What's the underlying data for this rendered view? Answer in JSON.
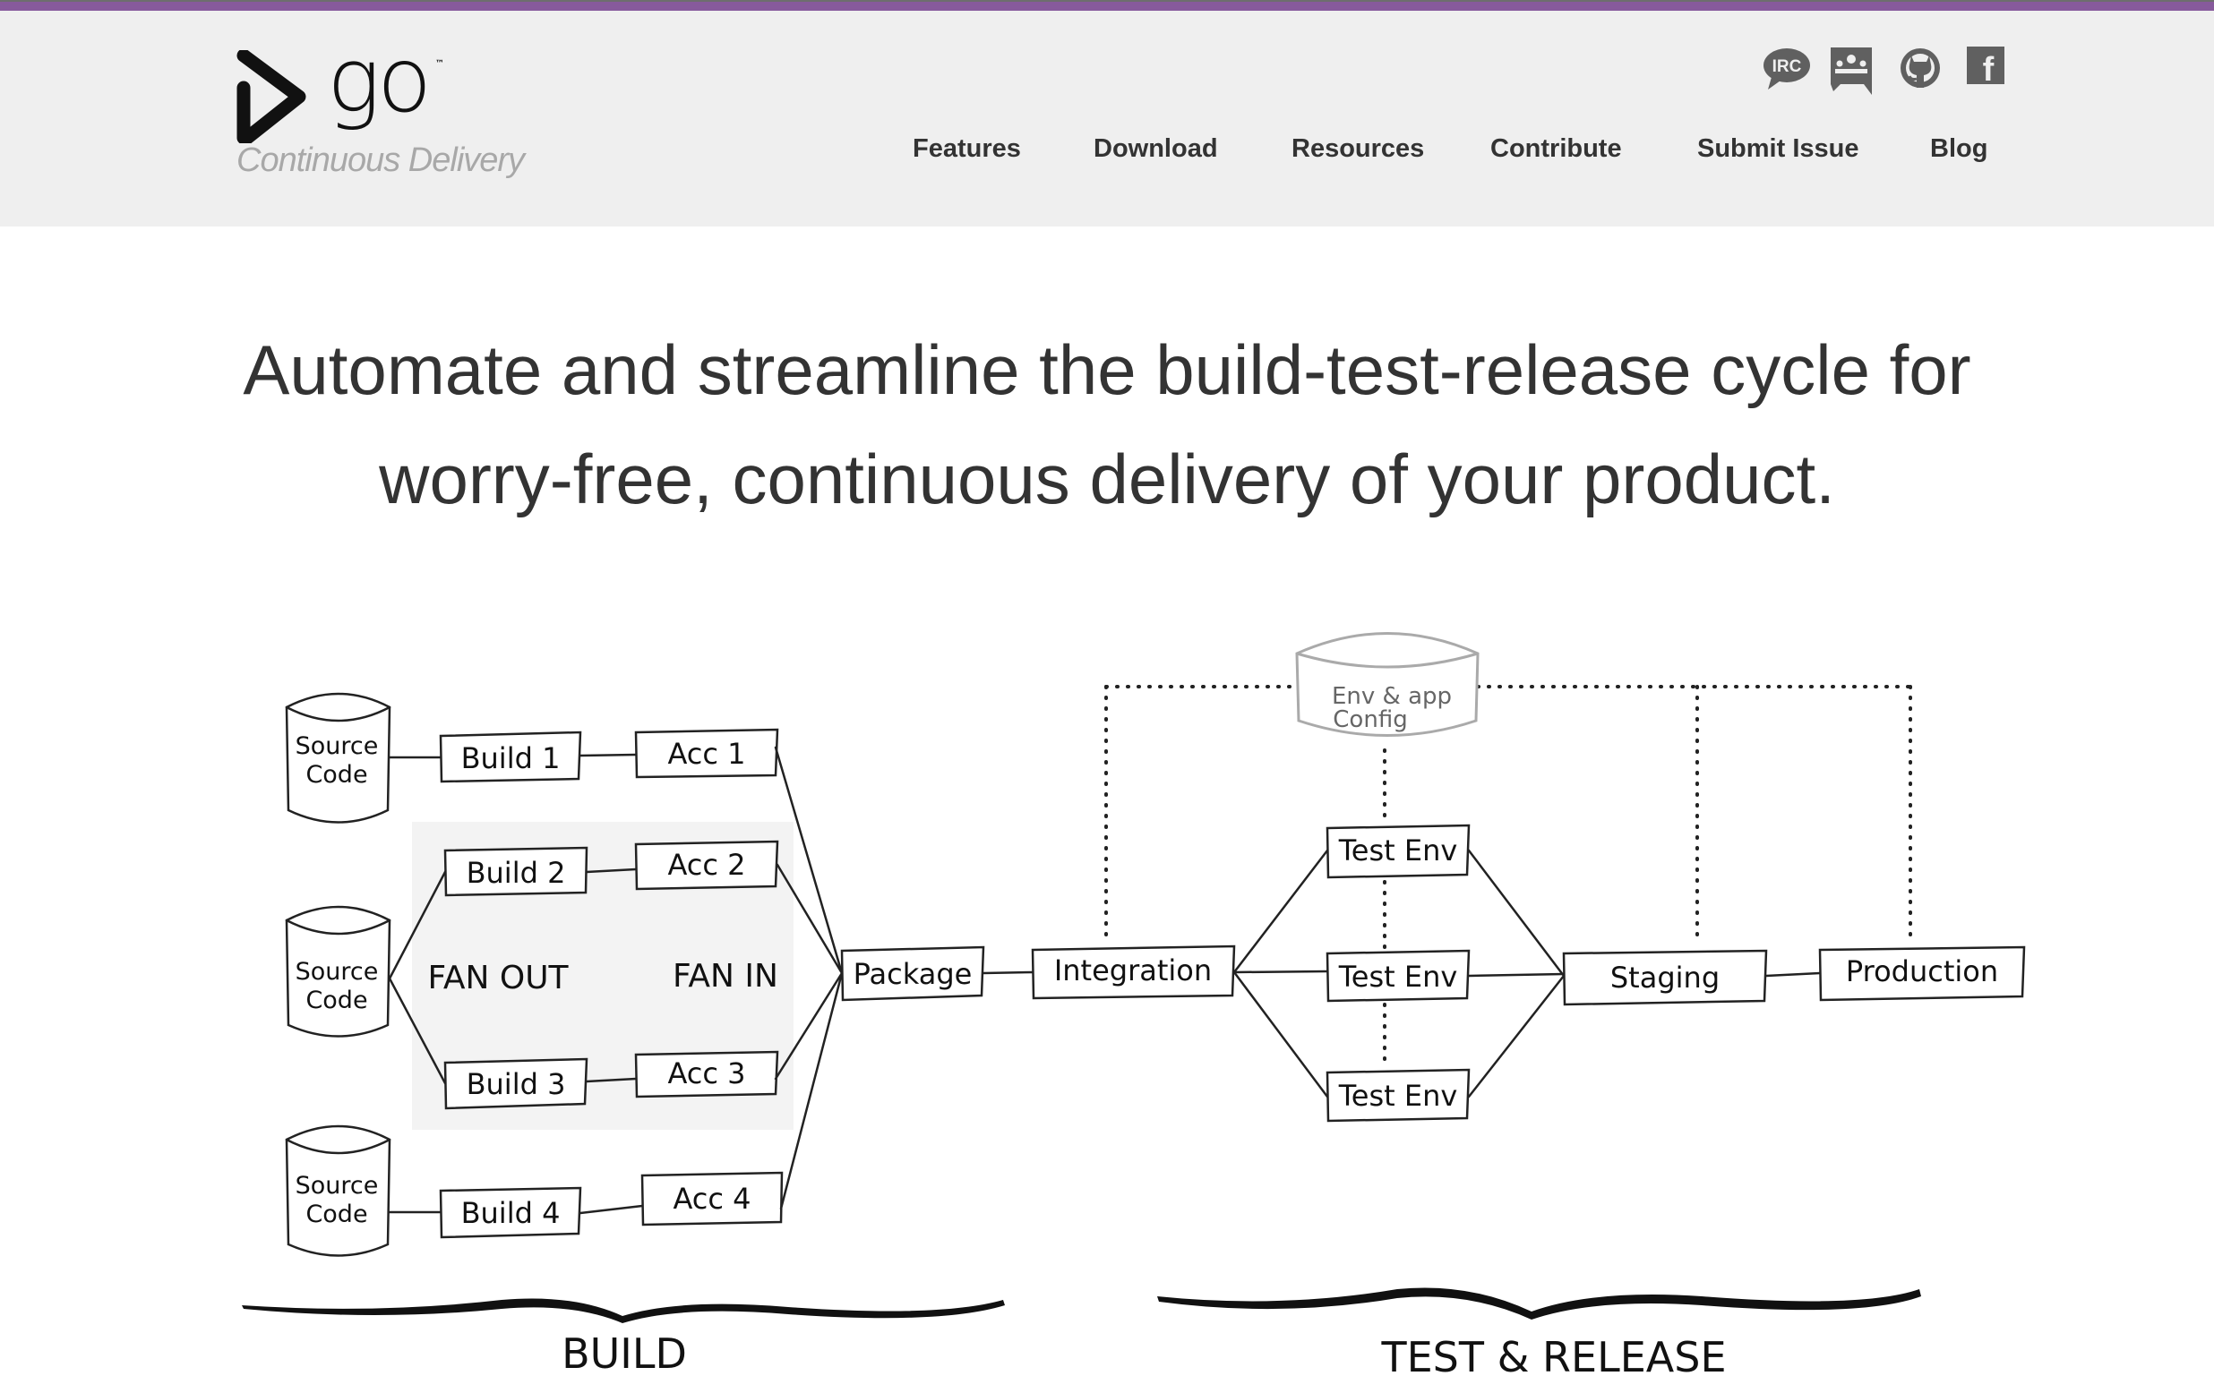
{
  "brand": {
    "name": "go",
    "trademark": "™",
    "tagline": "Continuous Delivery",
    "accent_color": "#875a9c",
    "header_bg": "#efefef"
  },
  "social": [
    {
      "icon": "irc-icon",
      "label": "IRC"
    },
    {
      "icon": "google-groups-icon",
      "label": ""
    },
    {
      "icon": "github-icon",
      "label": ""
    },
    {
      "icon": "facebook-icon",
      "label": "f"
    }
  ],
  "nav": {
    "items": [
      {
        "label": "Features"
      },
      {
        "label": "Download"
      },
      {
        "label": "Resources"
      },
      {
        "label": "Contribute"
      },
      {
        "label": "Submit Issue"
      },
      {
        "label": "Blog"
      }
    ]
  },
  "hero": {
    "line1": "Automate and streamline the build-test-release cycle for",
    "line2": "worry-free, continuous delivery of your product."
  },
  "diagram": {
    "sources": [
      {
        "line1": "Source",
        "line2": "Code"
      },
      {
        "line1": "Source",
        "line2": "Code"
      },
      {
        "line1": "Source",
        "line2": "Code"
      }
    ],
    "builds": [
      "Build 1",
      "Build 2",
      "Build 3",
      "Build 4"
    ],
    "accs": [
      "Acc 1",
      "Acc 2",
      "Acc 3",
      "Acc 4"
    ],
    "fan_out": "FAN OUT",
    "fan_in": "FAN IN",
    "package": "Package",
    "integration": "Integration",
    "config": {
      "line1": "Env & app",
      "line2": "Config"
    },
    "test_envs": [
      "Test Env",
      "Test Env",
      "Test Env"
    ],
    "staging": "Staging",
    "production": "Production",
    "section_build": "BUILD",
    "section_test_release": "TEST & RELEASE"
  }
}
